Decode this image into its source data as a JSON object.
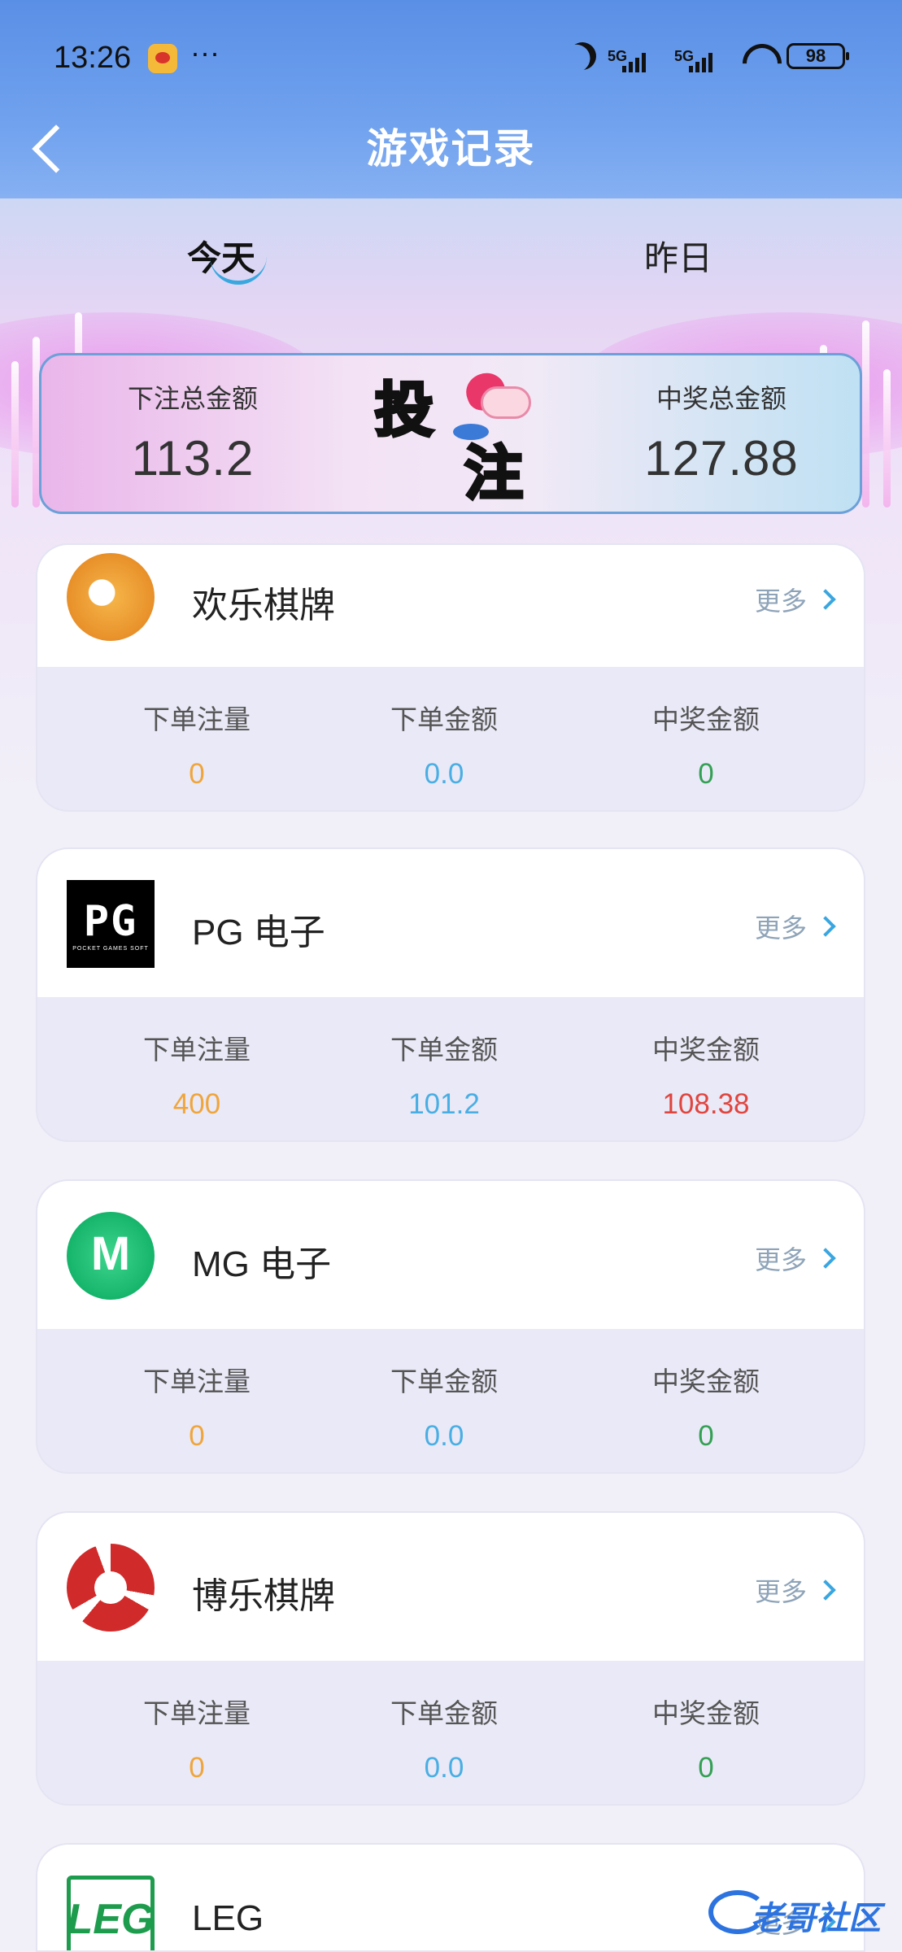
{
  "status_bar": {
    "time": "13:26",
    "dots": "···",
    "signal1": "5G",
    "signal2": "5G",
    "battery": "98"
  },
  "header": {
    "title": "游戏记录"
  },
  "tabs": {
    "today": "今天",
    "yesterday": "昨日"
  },
  "summary": {
    "bet_total_label": "下注总金额",
    "bet_total_value": "113.2",
    "win_total_label": "中奖总金额",
    "win_total_value": "127.88",
    "badge_char_1": "投",
    "badge_char_2": "注"
  },
  "stat_labels": {
    "bets": "下单注量",
    "amount": "下单金额",
    "win": "中奖金额"
  },
  "more_label": "更多",
  "games": [
    {
      "name": "欢乐棋牌",
      "bets": "0",
      "amount": "0.0",
      "win": "0",
      "win_color": "green"
    },
    {
      "name": "PG 电子",
      "bets": "400",
      "amount": "101.2",
      "win": "108.38",
      "win_color": "red",
      "logo_text": "PG",
      "logo_subtext": "POCKET GAMES SOFT"
    },
    {
      "name": "MG 电子",
      "bets": "0",
      "amount": "0.0",
      "win": "0",
      "win_color": "green"
    },
    {
      "name": "博乐棋牌",
      "bets": "0",
      "amount": "0.0",
      "win": "0",
      "win_color": "green"
    },
    {
      "name": "LEG",
      "logo_text": "LEG"
    }
  ],
  "watermark": {
    "text": "老哥社区"
  },
  "colors": {
    "header": "#5a8fe6",
    "bets_value": "#f0a53a",
    "amount_value": "#49aee3",
    "win_zero": "#33a053",
    "win_positive": "#e0453e",
    "more_link": "#8ea3b8"
  }
}
